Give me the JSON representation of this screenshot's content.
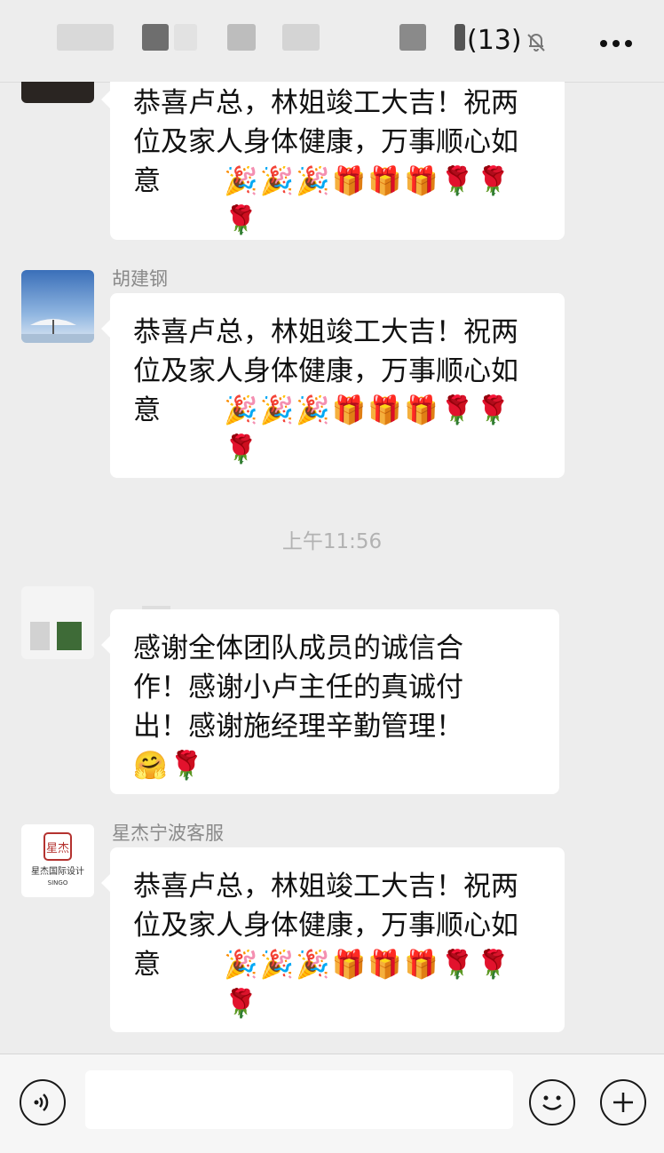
{
  "header": {
    "title_count": "(13)",
    "mute_icon": "bell-slash-icon",
    "more_icon": "more-dots-icon"
  },
  "messages": [
    {
      "sender": "",
      "text": "恭喜卢总，林姐竣工大吉！祝两位及家人身体健康，万事顺心如意",
      "emoji": "🎉🎉🎉🎁🎁🎁🌹🌹🌹"
    },
    {
      "sender": "胡建钢",
      "text": "恭喜卢总，林姐竣工大吉！祝两位及家人身体健康，万事顺心如意",
      "emoji": "🎉🎉🎉🎁🎁🎁🌹🌹🌹"
    },
    {
      "sender": "",
      "text": "感谢全体团队成员的诚信合作！感谢小卢主任的真诚付出！感谢施经理辛勤管理！",
      "emoji": "🤗🌹"
    },
    {
      "sender": "星杰宁波客服",
      "text": "恭喜卢总，林姐竣工大吉！祝两位及家人身体健康，万事顺心如意",
      "emoji": "🎉🎉🎉🎁🎁🎁🌹🌹🌹"
    }
  ],
  "timestamp": "上午11:56",
  "avatar_logo": {
    "line1": "星杰国际设计",
    "line2": "SINGO"
  },
  "input_bar": {
    "voice_icon": "voice-icon",
    "emoji_icon": "emoji-smile-icon",
    "add_icon": "plus-icon",
    "placeholder": ""
  },
  "colors": {
    "background": "#ededed",
    "bubble": "#ffffff"
  }
}
